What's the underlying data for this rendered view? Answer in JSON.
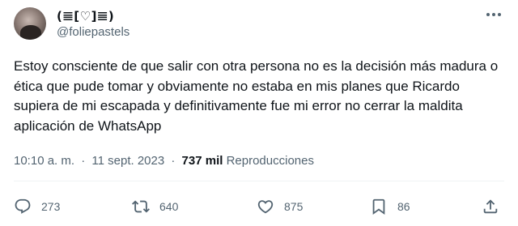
{
  "author": {
    "display_name": "(𝌆[♡]𝌆)",
    "handle": "@foliepastels"
  },
  "tweet": {
    "text": "Estoy consciente de que salir con otra persona no es la decisión más madura o ética que pude tomar y obviamente no estaba en mis planes que Ricardo supiera de mi escapada y definitivamente fue mi error no cerrar la maldita aplicación de WhatsApp",
    "time": "10:10 a. m.",
    "separator": "·",
    "date": "11 sept. 2023",
    "views_count": "737 mil",
    "views_label": "Reproducciones"
  },
  "actions": {
    "reply_count": "273",
    "retweet_count": "640",
    "like_count": "875",
    "bookmark_count": "86"
  },
  "icons": [
    "more-icon",
    "reply-icon",
    "retweet-icon",
    "like-icon",
    "bookmark-icon",
    "share-icon"
  ],
  "colors": {
    "text": "#0f1419",
    "secondary": "#536471",
    "divider": "#eff3f4"
  }
}
